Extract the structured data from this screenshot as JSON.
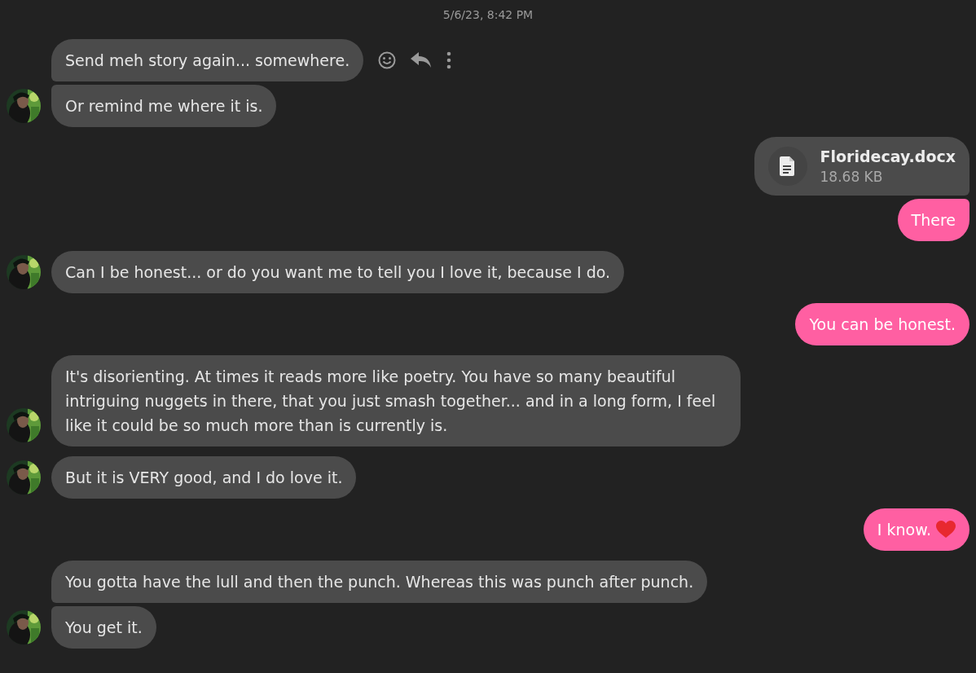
{
  "timestamp": "5/6/23, 8:42 PM",
  "groups": [
    {
      "outgoing": false,
      "messages": [
        {
          "kind": "text",
          "text": "Send meh story again... somewhere.",
          "hovered": true
        },
        {
          "kind": "text",
          "text": "Or remind me where it is.",
          "hovered": false
        }
      ]
    },
    {
      "outgoing": true,
      "messages": [
        {
          "kind": "file",
          "name": "Floridecay.docx",
          "size": "18.68 KB",
          "hovered": false
        },
        {
          "kind": "text",
          "text": "There",
          "hovered": false
        }
      ]
    },
    {
      "outgoing": false,
      "messages": [
        {
          "kind": "text",
          "text": "Can I be honest... or do you want me to tell you I love it, because I do.",
          "hovered": false
        }
      ]
    },
    {
      "outgoing": true,
      "messages": [
        {
          "kind": "text",
          "text": "You can be honest.",
          "hovered": false
        }
      ]
    },
    {
      "outgoing": false,
      "messages": [
        {
          "kind": "text",
          "text": "It's disorienting. At times it reads more like poetry. You have so many beautiful intriguing nuggets in there, that you just smash together... and in a long form, I feel like it could be so much more than is currently is.",
          "hovered": false
        }
      ]
    },
    {
      "outgoing": false,
      "messages": [
        {
          "kind": "text",
          "text": "But it is VERY good, and I do love it.",
          "hovered": false
        }
      ]
    },
    {
      "outgoing": true,
      "messages": [
        {
          "kind": "text",
          "text": "I know.",
          "heart_emoji": true,
          "hovered": false
        }
      ]
    },
    {
      "outgoing": false,
      "messages": [
        {
          "kind": "text",
          "text": "You gotta have the lull and then the punch. Whereas this was punch after punch.",
          "hovered": false
        },
        {
          "kind": "text",
          "text": "You get it.",
          "hovered": false
        }
      ]
    }
  ]
}
